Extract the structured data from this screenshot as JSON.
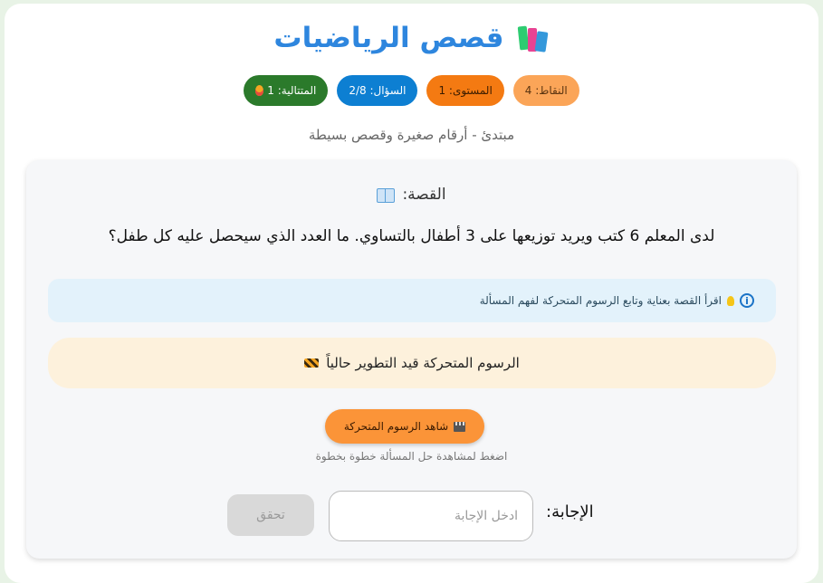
{
  "header": {
    "title": "قصص الرياضيات",
    "title_icon": "books-icon"
  },
  "badges": {
    "points": "النقاط: 4",
    "level": "المستوى: 1",
    "question": "السؤال: 2/8",
    "streak": "المتتالية: 1"
  },
  "subtitle": "مبتدئ - أرقام صغيرة وقصص بسيطة",
  "story": {
    "heading": "القصة:",
    "text": "لدى المعلم 6 كتب ويريد توزيعها على 3 أطفال بالتساوي. ما العدد الذي سيحصل عليه كل طفل؟"
  },
  "info": {
    "text": "اقرأ القصة بعناية وتابع الرسوم المتحركة لفهم المسألة"
  },
  "animation_notice": "الرسوم المتحركة قيد التطوير حالياً",
  "watch": {
    "button_label": "شاهد الرسوم المتحركة",
    "hint": "اضغط لمشاهدة حل المسألة خطوة بخطوة"
  },
  "answer": {
    "label": "الإجابة:",
    "placeholder": "ادخل الإجابة",
    "value": "",
    "check_label": "تحقق"
  },
  "colors": {
    "title": "#2e86de",
    "points_badge": "#fba558",
    "level_badge": "#f47a12",
    "question_badge": "#0d7fd2",
    "streak_badge": "#2b7a2b",
    "watch_button": "#fb9438",
    "check_button_disabled": "#d9d9d9"
  }
}
